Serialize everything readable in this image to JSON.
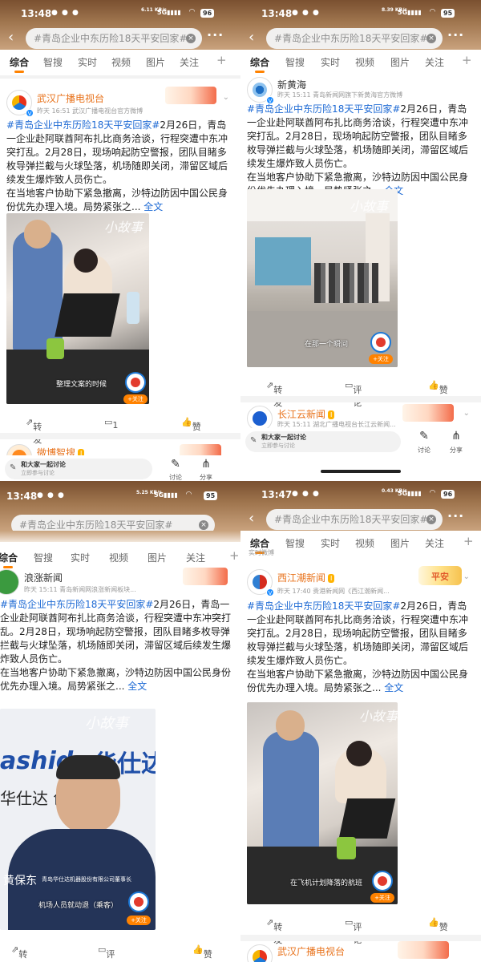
{
  "search": {
    "query": "#青岛企业中东历险18天平安回家#"
  },
  "tabs": [
    "综合",
    "智搜",
    "实时",
    "视频",
    "图片",
    "关注",
    "+"
  ],
  "screens": [
    {
      "status": {
        "time": "13:48",
        "speed": "6.11 KB/s",
        "battery": "96"
      },
      "post": {
        "name": "武汉广播电视台",
        "level": "🌻",
        "meta": "昨天 16:51  武汉广播电视台官方微博",
        "hashtag": "#青岛企业中东历险18天平安回家#",
        "text": "2月26日，青岛一企业赴阿联酋阿布扎比商务洽谈，行程突遭中东冲突打乱。2月28日，现场响起防空警报，团队目睹多枚导弹拦截与火球坠落，机场随即关闭，滞留区域后续发生爆炸致人员伤亡。",
        "text2": "在当地客户协助下紧急撤离，沙特边防因中国公民身份优先办理入境。局势紧张之...",
        "full": "全文",
        "brand": "小故事",
        "caption": "整理文案的时候",
        "follow": "+关注",
        "repost": "转发",
        "comments": "1",
        "likes": "赞"
      },
      "next": {
        "name": "微博智搜"
      },
      "footer": {
        "discuss_title": "和大家一起讨论",
        "discuss_sub": "立即参与讨论",
        "comment": "讨论",
        "share": "分享"
      }
    },
    {
      "status": {
        "time": "13:48",
        "speed": "8.39 KB/s",
        "battery": "95"
      },
      "post": {
        "name": "新黄海",
        "meta": "昨天 15:11  青岛新闻网旗下新黄海官方微博",
        "hashtag": "#青岛企业中东历险18天平安回家#",
        "text": "2月26日，青岛一企业赴阿联酋阿布扎比商务洽谈，行程突遭中东冲突打乱。2月28日，现场响起防空警报，团队目睹多枚导弹拦截与火球坠落，机场随即关闭，滞留区域后续发生爆炸致人员伤亡。",
        "text2": "在当地客户协助下紧急撤离，沙特边防因中国公民身份优先办理入境。局势紧张之...",
        "full": "全文",
        "brand": "小故事",
        "caption": "在那一个瞬间",
        "follow": "+关注",
        "repost": "转发",
        "comments": "评论",
        "likes": "赞"
      },
      "next": {
        "name": "长江云新闻",
        "meta": "昨天 15:11  湖北广播电视台长江云新闻..."
      },
      "footer": {
        "discuss_title": "和大家一起讨论",
        "discuss_sub": "立即参与讨论",
        "comment": "讨论",
        "share": "分享"
      }
    },
    {
      "status": {
        "time": "13:48",
        "speed": "5.25 KB/s",
        "battery": "95"
      },
      "post": {
        "name": "浪涨新闻",
        "meta": "昨天 15:11  青岛新闻网浪涨新闻板块...",
        "hashtag": "#青岛企业中东历险18天平安回家#",
        "text": "2月26日，青岛一企业赴阿联酋阿布扎比商务洽谈，行程突遭中东冲突打乱。2月28日，现场响起防空警报，团队目睹多枚导弹拦截与火球坠落，机场随即关闭，滞留区域后续发生爆炸致人员伤亡。",
        "text2": "在当地客户协助下紧急撤离，沙特边防因中国公民身份优先办理入境。局势紧张之...",
        "full": "全文",
        "brand": "小故事",
        "person": "黄保东",
        "person_title": "青岛华仕达机器股份有限公司董事长",
        "caption": "机场人员就动退（乘客）",
        "sign1": "ashid",
        "sign2": "华仕达 创",
        "sign3": "华仕达",
        "follow": "+关注",
        "repost": "转发",
        "comments": "评论",
        "likes": "赞"
      }
    },
    {
      "status": {
        "time": "13:47",
        "speed": "0.43 KB/s",
        "battery": "96"
      },
      "prev": "实时微博",
      "post": {
        "name": "西江潮新闻",
        "meta": "昨天 17:40  贵港新闻网《西江潮新闻...",
        "badge_text": "平安",
        "hashtag": "#青岛企业中东历险18天平安回家#",
        "text": "2月26日，青岛一企业赴阿联酋阿布扎比商务洽谈，行程突遭中东冲突打乱。2月28日，现场响起防空警报，团队目睹多枚导弹拦截与火球坠落，机场随即关闭，滞留区域后续发生爆炸致人员伤亡。",
        "text2": "在当地客户协助下紧急撤离，沙特边防因中国公民身份优先办理入境。局势紧张之...",
        "full": "全文",
        "brand": "小故事",
        "caption": "在飞机计划降落的航班",
        "follow": "+关注",
        "repost": "转发",
        "comments": "评论",
        "likes": "赞"
      },
      "next": {
        "name": "武汉广播电视台"
      }
    }
  ],
  "colors": {
    "accent": "#ff8200",
    "link": "#1e6ad4",
    "header": "#a0764f"
  },
  "icons": [
    "back-arrow-icon",
    "clear-icon",
    "more-icon",
    "verified-icon",
    "chevron-down-icon",
    "repost-icon",
    "comment-icon",
    "like-icon",
    "share-icon",
    "pen-icon"
  ]
}
